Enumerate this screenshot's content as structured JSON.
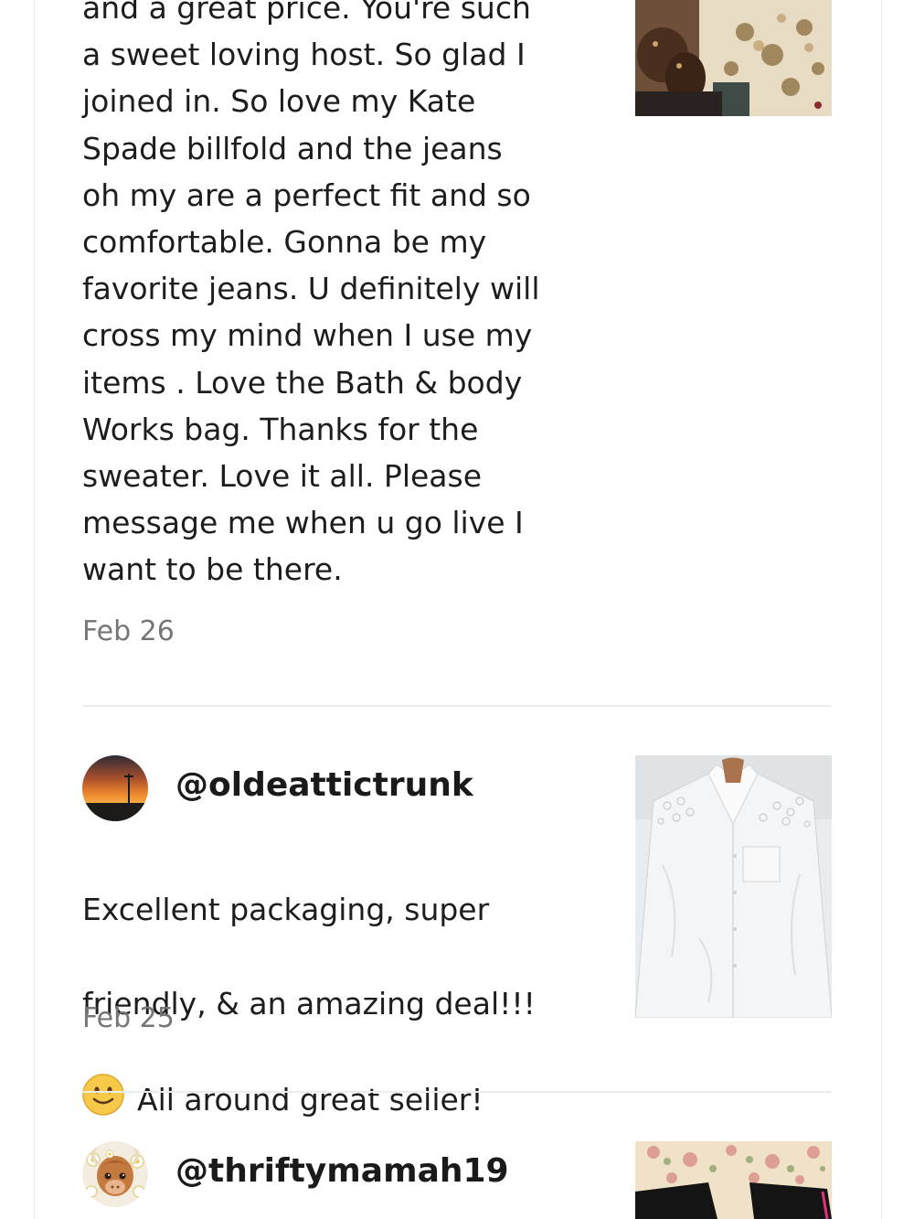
{
  "reviews": [
    {
      "text": "and a great price. You're such\na sweet loving host. So glad I\njoined in. So love my Kate\nSpade billfold and the jeans\noh my are a perfect fit and so\ncomfortable. Gonna be my\nfavorite jeans. U definitely will\ncross my mind when I use my\nitems . Love the Bath & body\nWorks bag. Thanks for the\nsweater. Love it all. Please\nmessage me when u go live I\nwant to be there.",
      "date": "Feb 26",
      "thumbnail_icon": "boots-on-floral-rug-photo"
    },
    {
      "username": "@oldeattictrunk",
      "avatar_icon": "sunset-avatar",
      "emoji_icon": "smiley-face-icon",
      "text_line1": "Excellent packaging, super",
      "text_line2": "friendly, & an amazing deal!!!",
      "text_line3": "All around great seller!",
      "date": "Feb 25",
      "thumbnail_icon": "white-lace-blouse-photo"
    },
    {
      "username": "@thriftymamah19",
      "avatar_icon": "highland-cow-avatar",
      "thumbnail_icon": "floral-fabric-photo"
    }
  ],
  "colors": {
    "text": "#1d1d1d",
    "date": "#767676",
    "divider": "#ececec"
  }
}
